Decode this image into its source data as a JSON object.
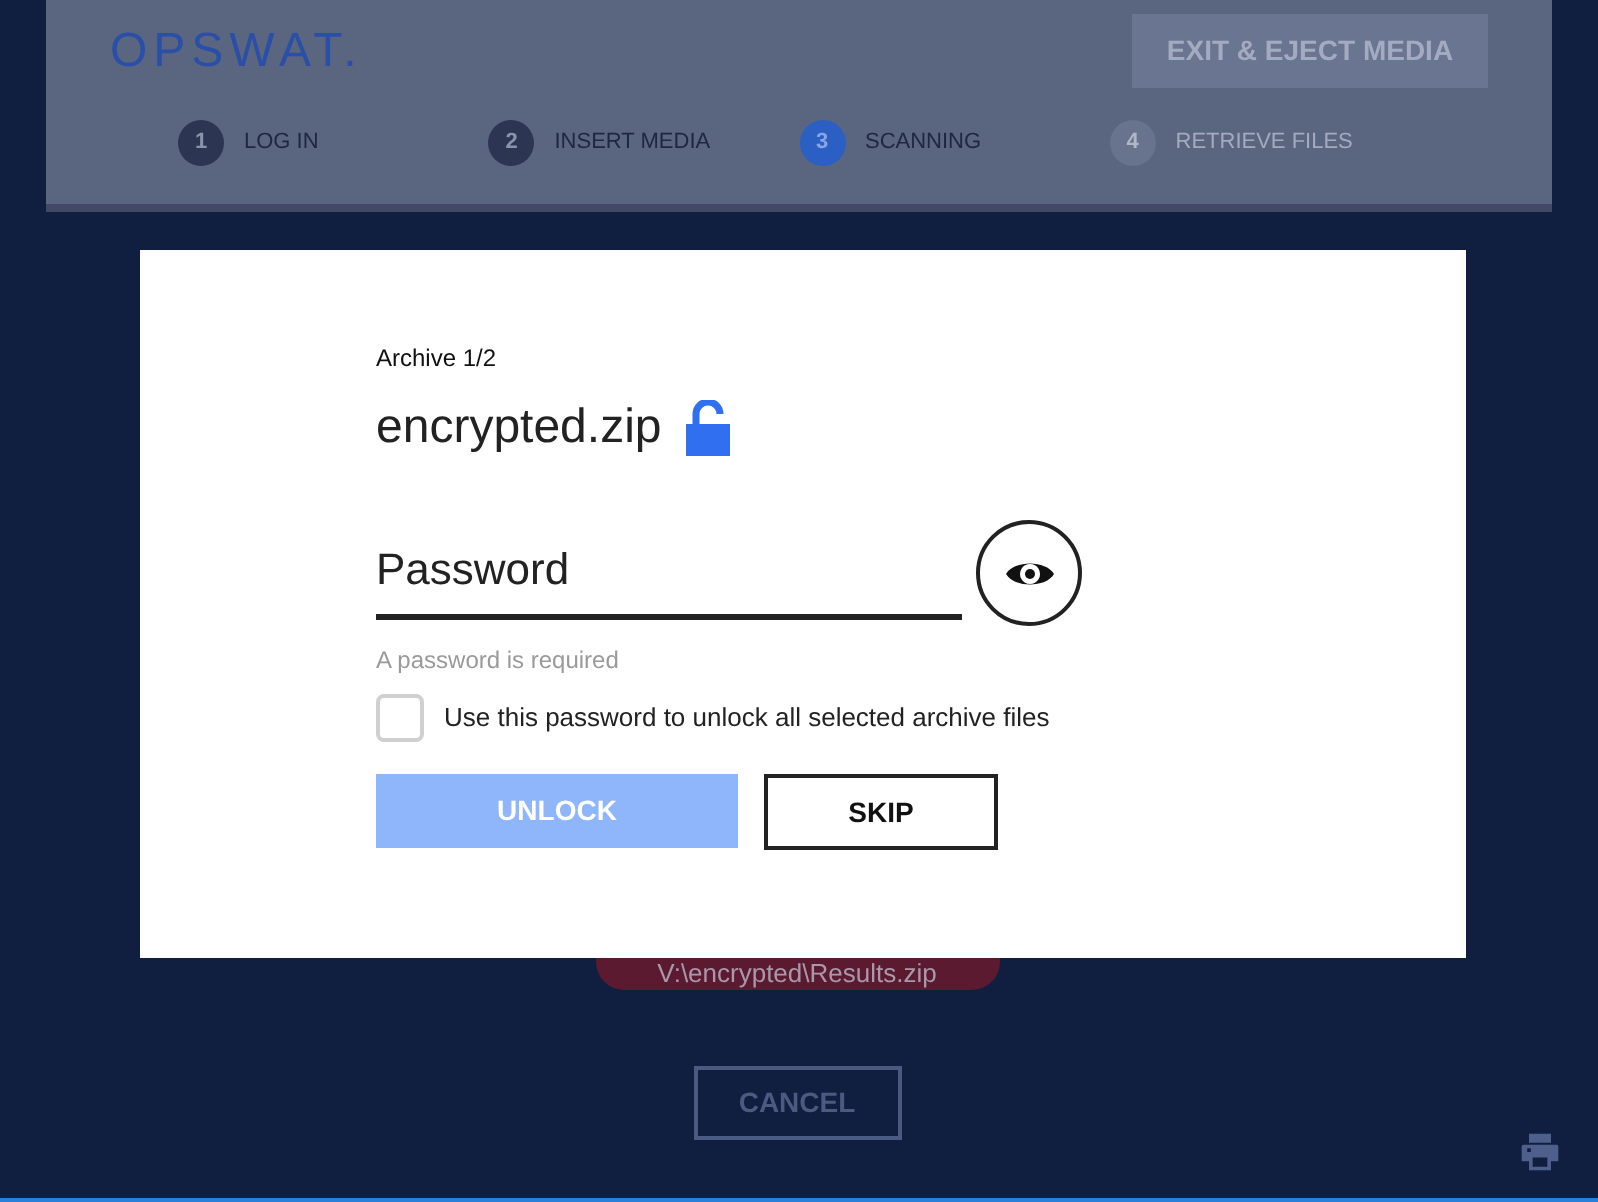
{
  "header": {
    "logo": "OPSWAT.",
    "exit_button": "EXIT & EJECT MEDIA"
  },
  "steps": [
    {
      "number": "1",
      "label": "LOG IN",
      "selected": false,
      "disabled": false
    },
    {
      "number": "2",
      "label": "INSERT MEDIA",
      "selected": false,
      "disabled": false
    },
    {
      "number": "3",
      "label": "SCANNING",
      "selected": true,
      "disabled": false
    },
    {
      "number": "4",
      "label": "RETRIEVE FILES",
      "selected": false,
      "disabled": true
    }
  ],
  "result_button": "V:\\encrypted\\Results.zip",
  "cancel_button": "CANCEL",
  "dialog": {
    "archive_count": "Archive 1/2",
    "file_name": "encrypted.zip",
    "password": {
      "placeholder": "Password"
    },
    "error": "A password is required",
    "apply_all": {
      "label": "Use this password to unlock all selected archive files",
      "checked": false
    },
    "unlock_button": {
      "label": "UNLOCK",
      "disabled": true
    },
    "skip_button": "SKIP"
  }
}
